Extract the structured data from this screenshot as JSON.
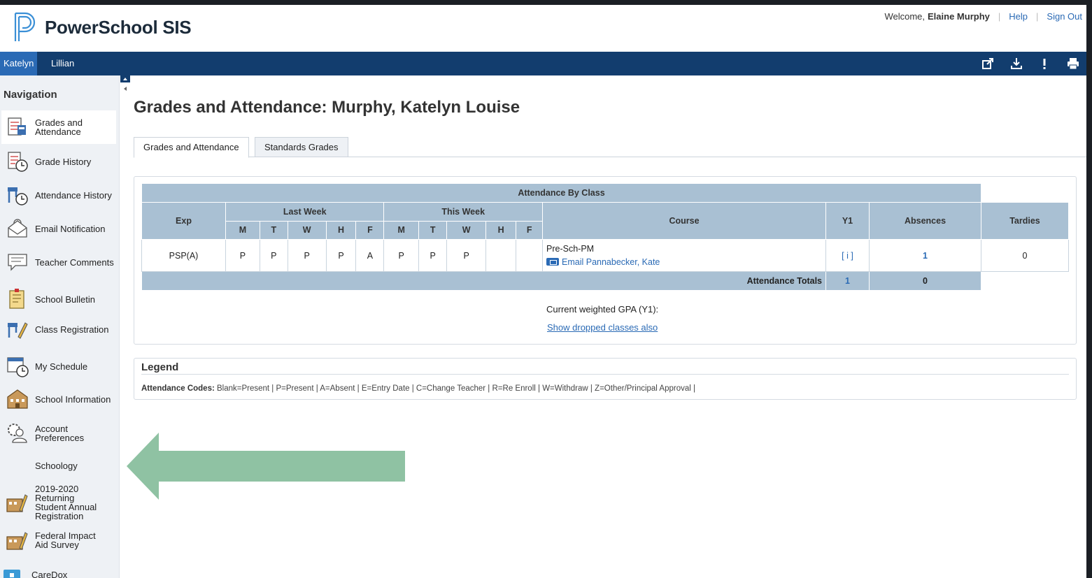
{
  "header": {
    "brand": "PowerSchool SIS",
    "welcome_prefix": "Welcome,",
    "user_name": "Elaine Murphy",
    "help_label": "Help",
    "signout_label": "Sign Out"
  },
  "student_tabs": [
    "Katelyn",
    "Lillian"
  ],
  "toolbar_icons": [
    "external-link-icon",
    "download-icon",
    "alert-icon",
    "print-icon"
  ],
  "nav": {
    "title": "Navigation",
    "items": [
      {
        "label": "Grades and Attendance",
        "icon": "grades-attendance-icon"
      },
      {
        "label": "Grade History",
        "icon": "grade-history-icon"
      },
      {
        "label": "Attendance History",
        "icon": "attendance-history-icon"
      },
      {
        "label": "Email Notification",
        "icon": "email-notification-icon"
      },
      {
        "label": "Teacher Comments",
        "icon": "teacher-comments-icon"
      },
      {
        "label": "School Bulletin",
        "icon": "school-bulletin-icon"
      },
      {
        "label": "Class Registration",
        "icon": "class-registration-icon"
      },
      {
        "label": "My Schedule",
        "icon": "my-schedule-icon"
      },
      {
        "label": "School Information",
        "icon": "school-information-icon"
      },
      {
        "label": "Account Preferences",
        "icon": "account-preferences-icon"
      },
      {
        "label": "Schoology",
        "icon": ""
      },
      {
        "label": "2019-2020 Returning Student Annual Registration",
        "icon": "registration-form-icon"
      },
      {
        "label": "Federal Impact Aid Survey",
        "icon": "survey-form-icon"
      },
      {
        "label": "CareDox",
        "icon": "caredox-icon"
      }
    ]
  },
  "page": {
    "title": "Grades and Attendance: Murphy, Katelyn Louise",
    "tabs": [
      "Grades and Attendance",
      "Standards Grades"
    ]
  },
  "attendance": {
    "caption": "Attendance By Class",
    "col_exp": "Exp",
    "col_last_week": "Last Week",
    "col_this_week": "This Week",
    "col_course": "Course",
    "col_y1": "Y1",
    "col_absences": "Absences",
    "col_tardies": "Tardies",
    "days": [
      "M",
      "T",
      "W",
      "H",
      "F",
      "M",
      "T",
      "W",
      "H",
      "F"
    ],
    "rows": [
      {
        "exp": "PSP(A)",
        "marks": [
          "P",
          "P",
          "P",
          "P",
          "A",
          "P",
          "P",
          "P",
          "",
          ""
        ],
        "course": "Pre-Sch-PM",
        "teacher_link": "Email Pannabecker, Kate",
        "y1": "[ i ]",
        "absences": "1",
        "tardies": "0"
      }
    ],
    "totals_label": "Attendance Totals",
    "totals_absences": "1",
    "totals_tardies": "0",
    "gpa_label": "Current weighted GPA (Y1):",
    "dropped_link": "Show dropped classes also"
  },
  "legend": {
    "title": "Legend",
    "codes_label": "Attendance Codes:",
    "codes_text": "Blank=Present | P=Present | A=Absent | E=Entry Date | C=Change Teacher | R=Re Enroll | W=Withdraw | Z=Other/Principal Approval |"
  },
  "colors": {
    "header_bar": "#123d6e",
    "active_tab": "#2a6ab5",
    "table_header": "#a9c0d3",
    "link": "#2a6ab5",
    "overlay_arrow": "#8fc2a3"
  }
}
